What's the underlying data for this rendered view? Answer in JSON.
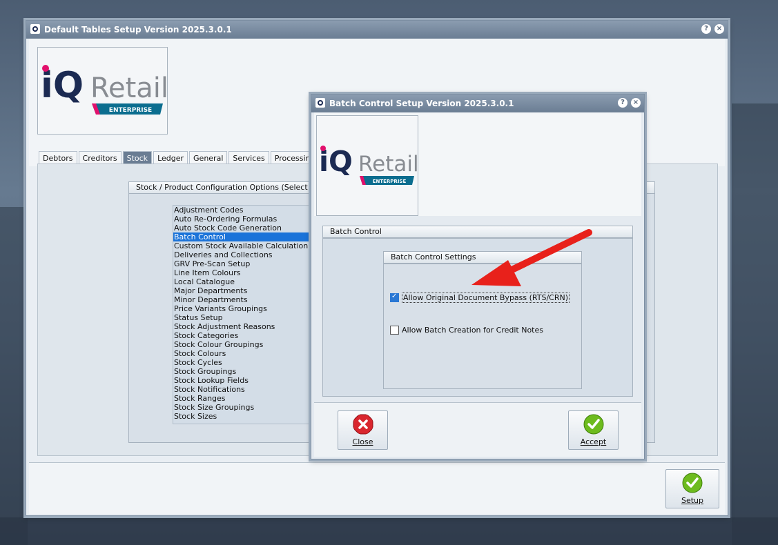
{
  "main_window": {
    "title": "Default Tables Setup Version 2025.3.0.1",
    "help_icon": "?",
    "close_icon": "×",
    "logo": {
      "text_iq": "iQ",
      "text_retail": "Retail",
      "text_edition": "ENTERPRISE"
    },
    "tabs": [
      "Debtors",
      "Creditors",
      "Stock",
      "Ledger",
      "General",
      "Services",
      "Processing"
    ],
    "active_tab": "Stock",
    "config_group_title": "Stock / Product Configuration Options (Select Item a",
    "options": [
      "Adjustment Codes",
      "Auto Re-Ordering Formulas",
      "Auto Stock Code Generation",
      "Batch Control",
      "Custom Stock Available Calculation",
      "Deliveries and Collections",
      "GRV Pre-Scan Setup",
      "Line Item Colours",
      "Local Catalogue",
      "Major Departments",
      "Minor Departments",
      "Price Variants Groupings",
      "Status Setup",
      "Stock Adjustment Reasons",
      "Stock Categories",
      "Stock Colour Groupings",
      "Stock Colours",
      "Stock Cycles",
      "Stock Groupings",
      "Stock Lookup Fields",
      "Stock Notifications",
      "Stock Ranges",
      "Stock Size Groupings",
      "Stock Sizes"
    ],
    "selected_option": "Batch Control",
    "setup_button": "Setup"
  },
  "dialog": {
    "title": "Batch Control Setup Version 2025.3.0.1",
    "help_icon": "?",
    "close_icon": "×",
    "logo": {
      "text_iq": "iQ",
      "text_retail": "Retail",
      "text_edition": "ENTERPRISE"
    },
    "section_title": "Batch Control",
    "settings_title": "Batch Control Settings",
    "checkboxes": [
      {
        "label": "Allow Original Document Bypass (RTS/CRN)",
        "checked": true
      },
      {
        "label": "Allow Batch Creation for Credit Notes",
        "checked": false
      }
    ],
    "close_button": "Close",
    "accept_button": "Accept"
  },
  "annotation": {
    "arrow_color": "#e8211b",
    "icon": "red-arrow"
  },
  "colors": {
    "accent_blue": "#1a73d9",
    "logo_navy": "#1b2a52",
    "logo_pink": "#e2106c",
    "logo_teal": "#0b6d8f",
    "accept_green": "#6dbb1e",
    "close_red": "#d9262e"
  }
}
